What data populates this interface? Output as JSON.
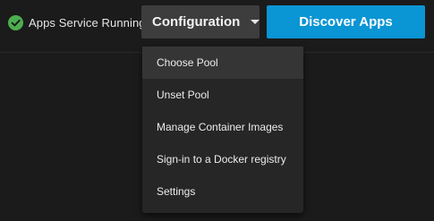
{
  "header": {
    "status_text": "Apps Service Running",
    "status_icon": "check-circle-icon",
    "status_color": "#4caf50",
    "configuration_label": "Configuration",
    "discover_label": "Discover Apps",
    "discover_color": "#0a95d4"
  },
  "menu": {
    "items": [
      {
        "label": "Choose Pool"
      },
      {
        "label": "Unset Pool"
      },
      {
        "label": "Manage Container Images"
      },
      {
        "label": "Sign-in to a Docker registry"
      },
      {
        "label": "Settings"
      }
    ]
  }
}
